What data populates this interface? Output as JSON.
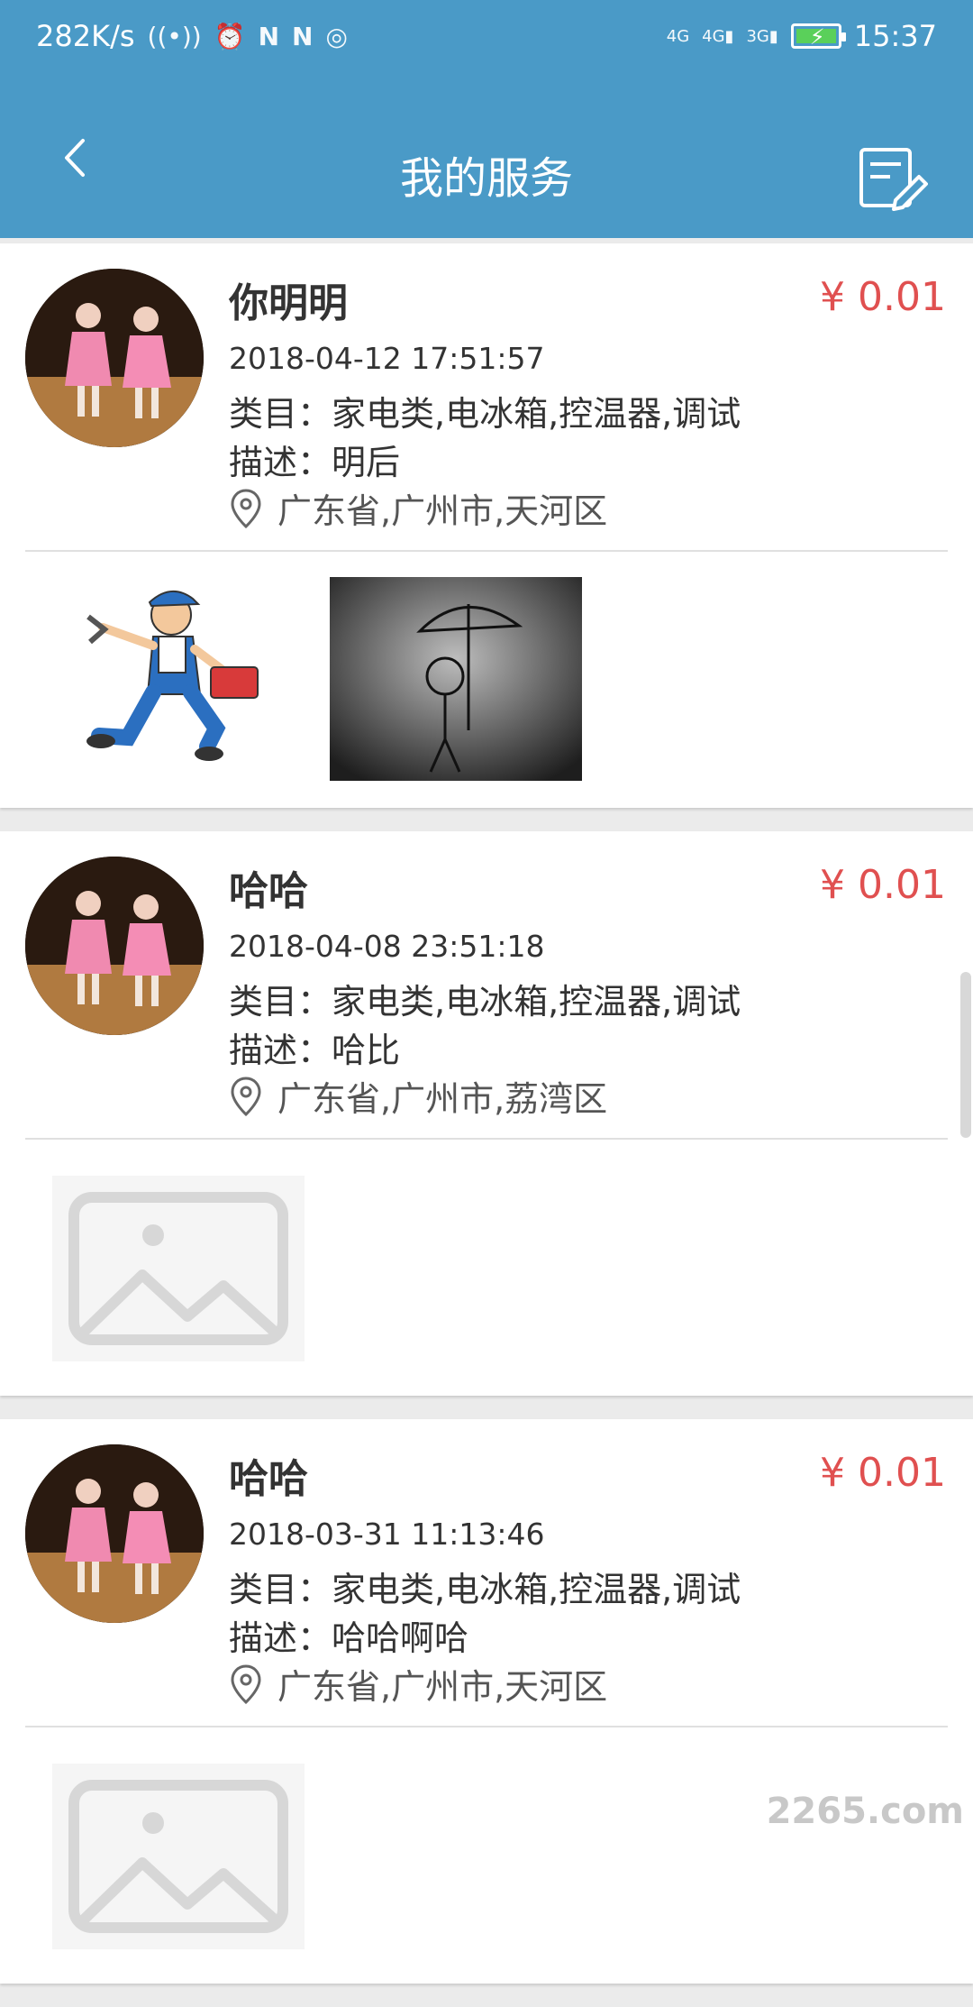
{
  "status_bar": {
    "net_speed": "282K/s",
    "time": "15:37",
    "icons": [
      "hotspot-icon",
      "alarm-icon",
      "n-icon",
      "n-icon",
      "nfc-icon",
      "4g-icon",
      "4g-icon",
      "3g-icon",
      "battery-icon"
    ]
  },
  "header": {
    "title": "我的服务",
    "back_icon": "chevron-left-icon",
    "edit_icon": "edit-note-icon"
  },
  "orders": [
    {
      "name": "你明明",
      "price": "¥ 0.01",
      "date": "2018-04-12 17:51:57",
      "category": "类目：家电类,电冰箱,控温器,调试",
      "description": "描述：明后",
      "location": "广东省,广州市,天河区",
      "images": [
        "repairman-image",
        "rain-umbrella-image"
      ]
    },
    {
      "name": "哈哈",
      "price": "¥ 0.01",
      "date": "2018-04-08 23:51:18",
      "category": "类目：家电类,电冰箱,控温器,调试",
      "description": "描述：哈比",
      "location": "广东省,广州市,荔湾区",
      "images": [
        "placeholder-image"
      ]
    },
    {
      "name": "哈哈",
      "price": "¥ 0.01",
      "date": "2018-03-31 11:13:46",
      "category": "类目：家电类,电冰箱,控温器,调试",
      "description": "描述：哈哈啊哈",
      "location": "广东省,广州市,天河区",
      "images": [
        "placeholder-image"
      ]
    }
  ],
  "watermark": "2265.com",
  "colors": {
    "header_bg": "#4a9ac7",
    "price": "#e05050",
    "text": "#333333"
  }
}
